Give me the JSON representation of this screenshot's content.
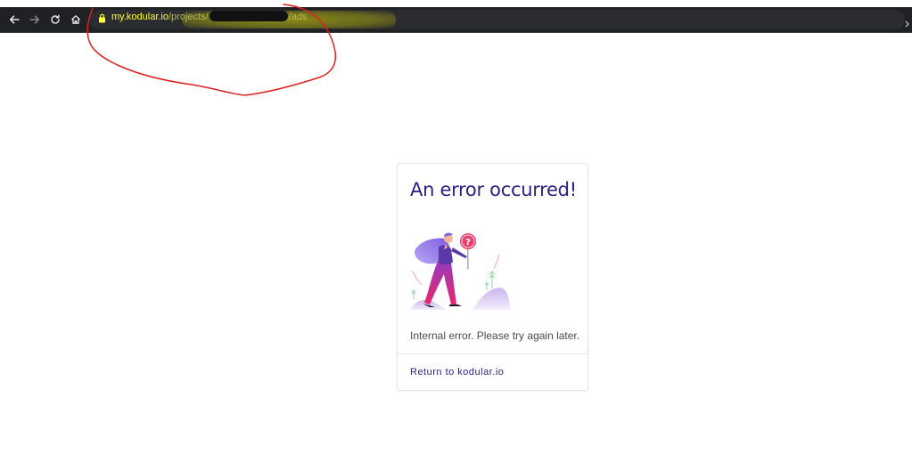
{
  "browser": {
    "url": {
      "host": "my.kodular.io",
      "path_prefix": "/projects/",
      "path_suffix": "/ads"
    },
    "icons": [
      "back-icon",
      "forward-icon",
      "reload-icon",
      "home-icon",
      "lock-icon",
      "overflow-arrow-icon"
    ]
  },
  "error_card": {
    "title": "An error occurred!",
    "message": "Internal error. Please try again later.",
    "link_label": "Return to kodular.io"
  },
  "colors": {
    "toolbar_bg": "#202124",
    "url_host": "#ffff33",
    "title_accent": "#2b1f86",
    "annotation_red": "#e02020"
  }
}
